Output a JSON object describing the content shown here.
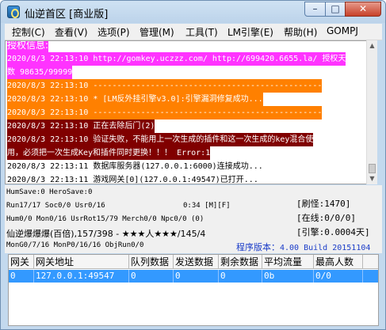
{
  "window": {
    "title": "仙逆首区 [商业版]",
    "minimize": "–",
    "maximize": "□",
    "close": "✕"
  },
  "menu": [
    {
      "label": "控制(C)"
    },
    {
      "label": "查看(V)"
    },
    {
      "label": "选项(P)"
    },
    {
      "label": "管理(M)"
    },
    {
      "label": "工具(T)"
    },
    {
      "label": "LM引擎(E)"
    },
    {
      "label": "帮助(H)"
    },
    {
      "label": "GOMPJ"
    }
  ],
  "log": [
    {
      "text": "授权信息:",
      "bg": "#ff33ff",
      "color": "#ffffff"
    },
    {
      "text": "2020/8/3 22:13:10 http://gomkey.uczzz.com/ http://699420.6655.la/ 授权天",
      "bg": "#ff33ff",
      "color": "#ffffff"
    },
    {
      "text": "数 98635/99999",
      "bg": "#ff33ff",
      "color": "#ffffff"
    },
    {
      "text": "2020/8/3 22:13:10 ------------------------------------------------",
      "bg": "#ff8000",
      "color": "#ffffff"
    },
    {
      "text": "2020/8/3 22:13:10 * [LM反外挂引擎v3.0]:引擎漏洞修复成功...",
      "bg": "#ff8000",
      "color": "#ffffff"
    },
    {
      "text": "2020/8/3 22:13:10 ------------------------------------------------",
      "bg": "#ff8000",
      "color": "#ffffff"
    },
    {
      "text": "2020/8/3 22:13:10 正在去除后门(2)",
      "bg": "#800000",
      "color": "#ffffff"
    },
    {
      "text": "2020/8/3 22:13:10 验证失败，不能用上一次生成的插件和这一次生成的key混合使",
      "bg": "#800000",
      "color": "#ffffff"
    },
    {
      "text": "用，必须把一次生成Key和插件同时更换！！！  Error:1",
      "bg": "#800000",
      "color": "#ffffff"
    },
    {
      "text": "2020/8/3 22:13:11 数据库服务器(127.0.0.1:6000)连接成功...",
      "bg": "#ffffff",
      "color": "#000000"
    },
    {
      "text": "2020/8/3 22:13:11 游戏网关[0](127.0.0.1:49547)已打开...",
      "bg": "#ffffff",
      "color": "#000000"
    }
  ],
  "status": {
    "line1": "HumSave:0 HeroSave:0",
    "line2": "Run17/17 Soc0/0 Usr0/16",
    "runtime": "0:34 [M][F]",
    "line3": "Hum0/0 Mon0/16 UsrRot15/79 Merch0/0 Npc0/0 (0)",
    "line4": "仙逆爆爆爆(百倍),157/398 - ★★★人★★★/145/4",
    "line5": "MonG0/7/16 MonP0/16/16 ObjRun0/0",
    "refresh": "[刷怪:1470]",
    "online": "[在线:0/0/0]",
    "engine": "[引擎:0.0004天]",
    "version_label": "程序版本：",
    "version_value": "4.00 Build 20151104"
  },
  "table": {
    "columns": [
      "网关",
      "网关地址",
      "队列数据",
      "发送数据",
      "剩余数据",
      "平均流量",
      "最高人数"
    ],
    "rows": [
      [
        "0",
        "127.0.0.1:49547",
        "0",
        "0",
        "0",
        "0b",
        "0/0"
      ]
    ]
  }
}
